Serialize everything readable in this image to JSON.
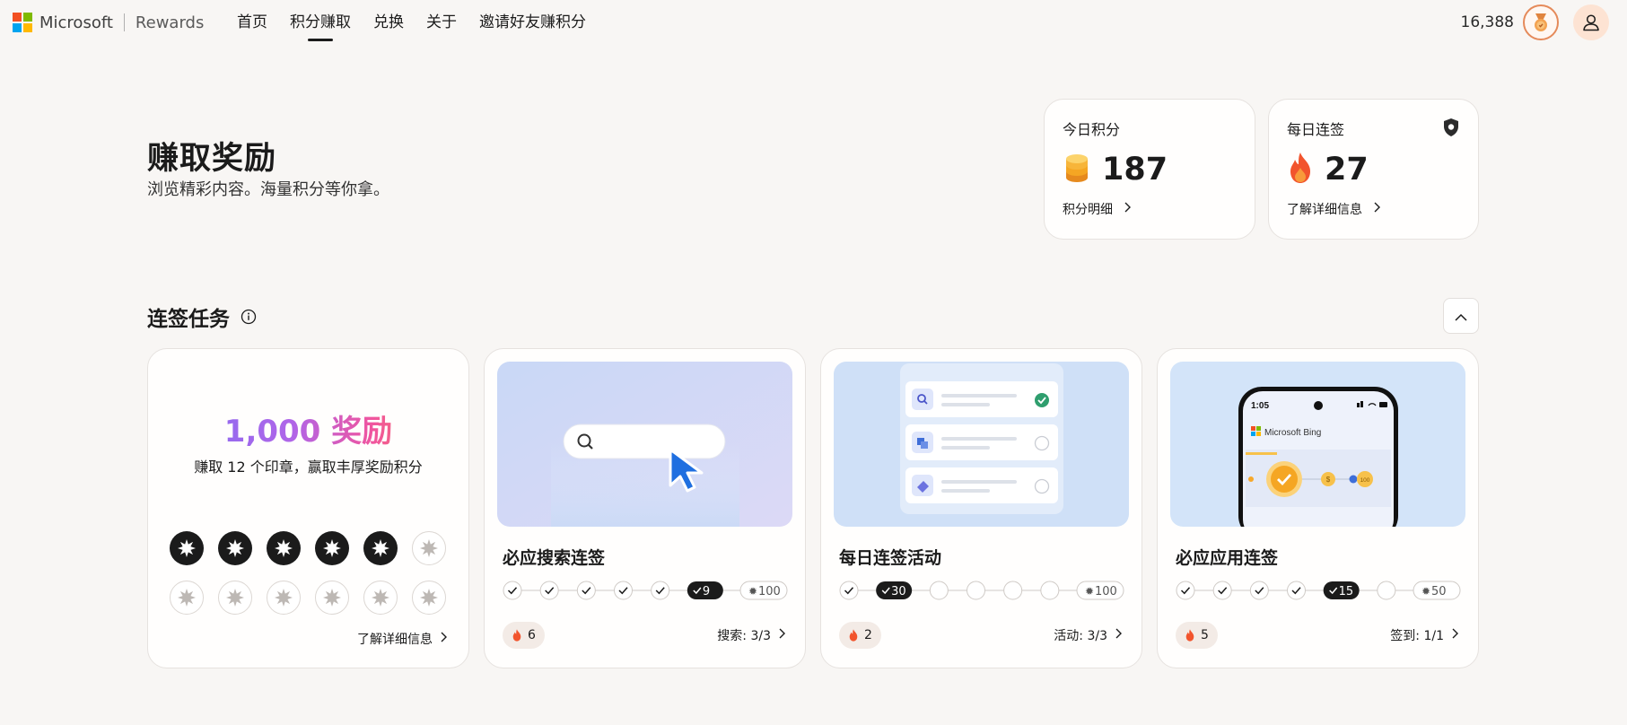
{
  "header": {
    "brand": "Microsoft",
    "product": "Rewards",
    "nav": [
      "首页",
      "积分赚取",
      "兑换",
      "关于",
      "邀请好友赚积分"
    ],
    "active_nav": 1,
    "points_total": "16,388",
    "colors": {
      "ms_red": "#f25022",
      "ms_green": "#7fba00",
      "ms_blue": "#00a4ef",
      "ms_yellow": "#ffb900"
    },
    "icons": [
      "level-badge-icon",
      "user-icon"
    ]
  },
  "hero": {
    "title": "赚取奖励",
    "subtitle": "浏览精彩内容。海量积分等你拿。"
  },
  "stats": {
    "today": {
      "label": "今日积分",
      "value": "187",
      "link": "积分明细",
      "icon": "coin-stack-icon"
    },
    "streak": {
      "label": "每日连签",
      "value": "27",
      "link": "了解详细信息",
      "icon": "flame-icon",
      "badge_icon": "shield-icon"
    }
  },
  "section": {
    "title": "连签任务",
    "info_icon": "info-icon",
    "collapse_icon": "chevron-up-icon"
  },
  "stamp_card": {
    "reward_title": "1,000 奖励",
    "subtitle": "赚取 12 个印章，赢取丰厚奖励积分",
    "stamps_total": 12,
    "stamps_earned": 5,
    "link": "了解详细信息"
  },
  "tasks": [
    {
      "title": "必应搜索连签",
      "checks_before": 5,
      "current": "9",
      "remaining": 0,
      "goal": "100",
      "streak": "6",
      "count_label": "搜索: 3/3",
      "illustration": "search-bar-cursor"
    },
    {
      "title": "每日连签活动",
      "checks_before": 1,
      "current": "30",
      "remaining": 4,
      "goal": "100",
      "streak": "2",
      "count_label": "活动: 3/3",
      "illustration": "activity-checklist"
    },
    {
      "title": "必应应用连签",
      "checks_before": 4,
      "current": "15",
      "remaining": 1,
      "goal": "50",
      "streak": "5",
      "count_label": "签到: 1/1",
      "illustration": "phone-bing-app",
      "phone": {
        "time": "1:05",
        "app_name": "Microsoft Bing",
        "small_badge": "100"
      }
    }
  ]
}
